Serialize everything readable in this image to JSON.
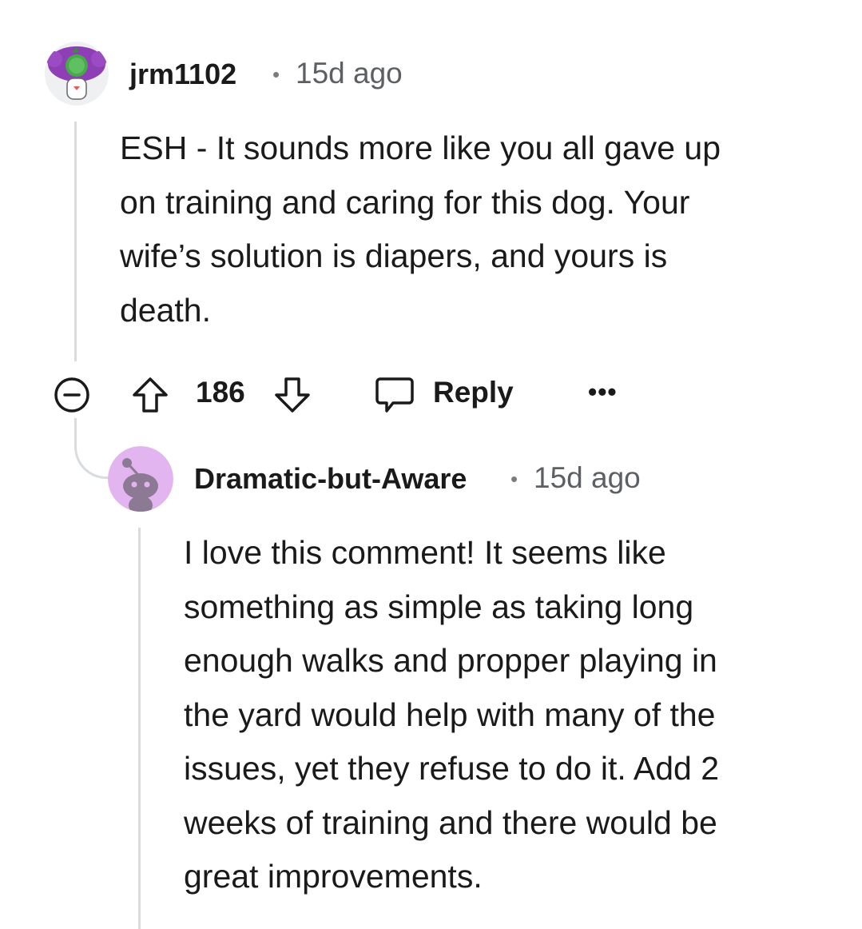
{
  "comments": [
    {
      "username": "jrm1102",
      "separator": "•",
      "timestamp": "15d ago",
      "avatar_icon": "snoo-avatar-purple-hair-icon",
      "body_lines": [
        "ESH - It sounds more like you all gave up",
        "on training and caring for this dog. Your",
        "wife’s solution is diapers, and yours is",
        "death."
      ],
      "actions": {
        "collapse_icon": "minus-circle-icon",
        "upvote_icon": "upvote-arrow-icon",
        "vote_count": "186",
        "downvote_icon": "downvote-arrow-icon",
        "reply_icon": "speech-bubble-icon",
        "reply_label": "Reply",
        "more_label": "•••"
      }
    },
    {
      "username": "Dramatic-but-Aware",
      "separator": "•",
      "timestamp": "15d ago",
      "avatar_icon": "default-snoo-avatar-icon",
      "body_lines": [
        "I love this comment! It seems like",
        "something as simple as taking long",
        "enough walks and propper playing in",
        "the yard would help with many of the",
        "issues, yet they refuse to do it. Add 2",
        "weeks of training and there would be",
        "great improvements."
      ]
    }
  ],
  "colors": {
    "thread_line": "#d9dcdf",
    "text": "#1a1a1b",
    "meta": "#5c6064",
    "avatar2_bg": "#e3b5f0",
    "avatar2_snoo": "#8c7a94"
  }
}
